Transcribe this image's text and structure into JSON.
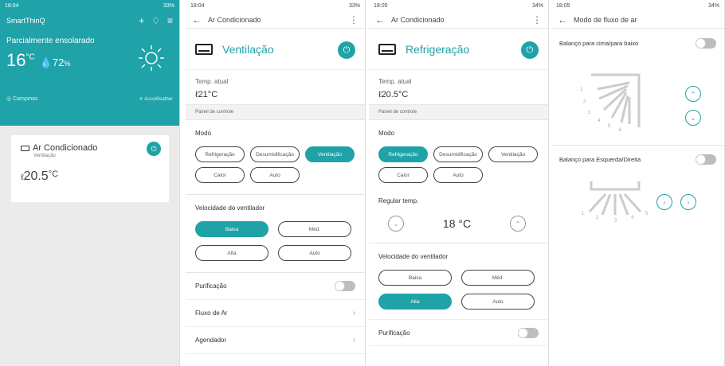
{
  "screen1": {
    "status": {
      "time": "18:04",
      "battery": "33%"
    },
    "app_title": "SmartThinQ",
    "weather": {
      "condition": "Parcialmente ensolarado",
      "temp": "16",
      "temp_unit": "°C",
      "humidity": "72",
      "humidity_unit": "%",
      "location": "Campinas",
      "provider": "AccuWeather"
    },
    "device": {
      "name": "Ar Condicionado",
      "mode": "Ventilação",
      "temp": "20.5",
      "temp_unit": "°C"
    }
  },
  "screen2": {
    "status": {
      "time": "18:04",
      "battery": "33%"
    },
    "title": "Ar Condicionado",
    "mode_label": "Ventilação",
    "current_temp_label": "Temp. atual",
    "current_temp": "21°C",
    "panel_label": "Painel de controle",
    "mode_section": "Modo",
    "modes": [
      "Refrigeração",
      "Desumidificação",
      "Ventilação",
      "Calor",
      "Auto"
    ],
    "active_mode": "Ventilação",
    "fan_label": "Velocidade do ventilador",
    "fan_speeds": [
      "Baixa",
      "Méd.",
      "Alta",
      "Auto"
    ],
    "active_fan": "Baixa",
    "purification": "Purificação",
    "airflow": "Fluxo de Ar",
    "scheduler": "Agendador"
  },
  "screen3": {
    "status": {
      "time": "18:05",
      "battery": "34%"
    },
    "title": "Ar Condicionado",
    "mode_label": "Refrigeração",
    "current_temp_label": "Temp. atual",
    "current_temp": "20.5°C",
    "panel_label": "Painel de controle",
    "mode_section": "Modo",
    "modes": [
      "Refrigeração",
      "Desumidificação",
      "Ventilação",
      "Calor",
      "Auto"
    ],
    "active_mode": "Refrigeração",
    "set_temp_label": "Regular temp.",
    "set_temp": "18 °C",
    "fan_label": "Velocidade do ventilador",
    "fan_speeds": [
      "Baixa",
      "Méd.",
      "Alta",
      "Auto"
    ],
    "active_fan": "Alta",
    "purification": "Purificação"
  },
  "screen4": {
    "status": {
      "time": "18:05",
      "battery": "34%"
    },
    "title": "Modo de fluxo de ar",
    "vertical_swing": "Balanço para cima/para baixo",
    "horizontal_swing": "Balanço para Esquerda/Direita",
    "vertical_positions": [
      "1",
      "2",
      "3",
      "4",
      "5",
      "6"
    ],
    "horizontal_positions": [
      "1",
      "2",
      "3",
      "4",
      "5"
    ]
  },
  "colors": {
    "accent": "#1fa2a8"
  }
}
